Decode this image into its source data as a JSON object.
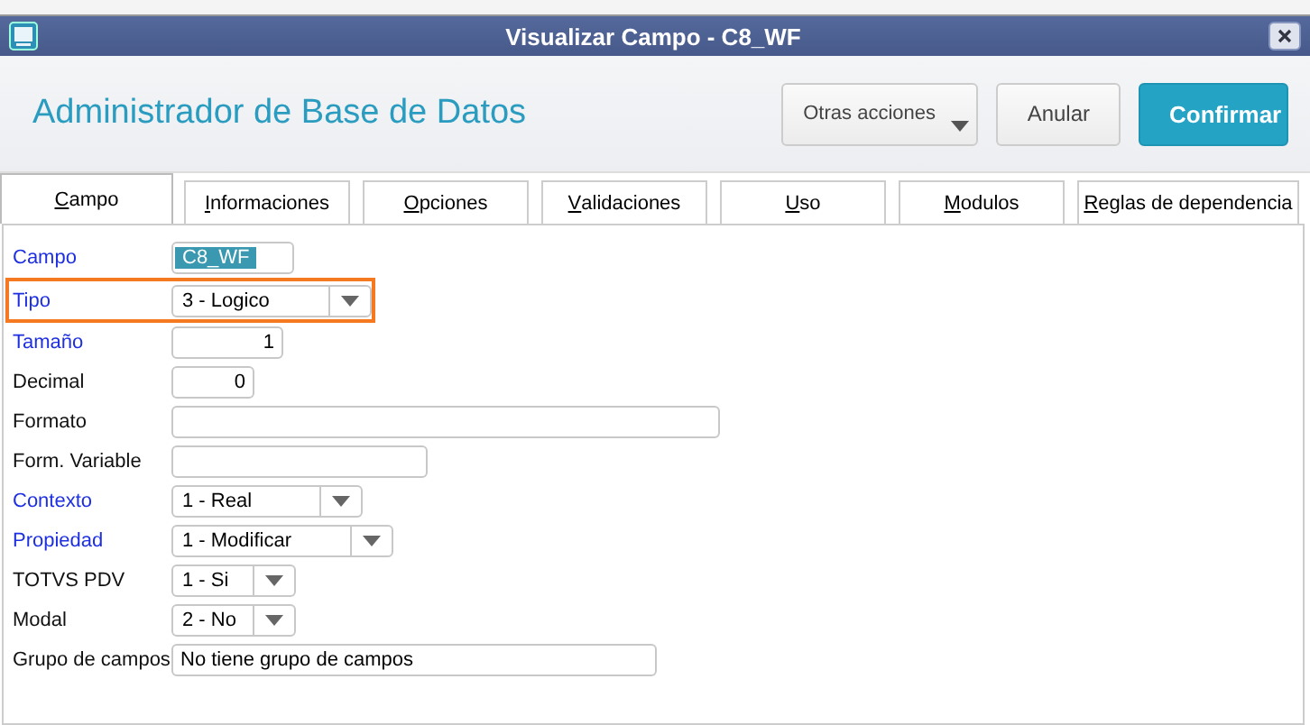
{
  "window": {
    "title": "Visualizar Campo - C8_WF"
  },
  "header": {
    "title": "Administrador de Base de Datos",
    "buttons": [
      {
        "label": "Otras acciones",
        "kind": "menu"
      },
      {
        "label": "Anular",
        "kind": "plain"
      },
      {
        "label": "Confirmar",
        "kind": "primary"
      }
    ]
  },
  "tabs": [
    {
      "label": "Campo",
      "selected": true
    },
    {
      "label": "Informaciones",
      "selected": false
    },
    {
      "label": "Opciones",
      "selected": false
    },
    {
      "label": "Validaciones",
      "selected": false
    },
    {
      "label": "Uso",
      "selected": false
    },
    {
      "label": "Modulos",
      "selected": false
    },
    {
      "label": "Reglas de dependencia",
      "selected": false
    }
  ],
  "fields": [
    {
      "label": "Campo",
      "required": true,
      "kind": "text",
      "value": "C8_WF",
      "text_selected": true,
      "highlighted": false
    },
    {
      "label": "Tipo",
      "required": true,
      "kind": "select",
      "value": "3 - Logico",
      "highlighted": true
    },
    {
      "label": "Tamaño",
      "required": true,
      "kind": "number",
      "value": "1",
      "text_selected": false,
      "highlighted": false
    },
    {
      "label": "Decimal",
      "required": false,
      "kind": "number",
      "value": "0",
      "text_selected": false,
      "highlighted": false
    },
    {
      "label": "Formato",
      "required": false,
      "kind": "text",
      "highlighted": false
    },
    {
      "label": "Form. Variable",
      "required": false,
      "kind": "text",
      "highlighted": false
    },
    {
      "label": "Contexto",
      "required": true,
      "kind": "select",
      "value": "1 - Real",
      "highlighted": false
    },
    {
      "label": "Propiedad",
      "required": true,
      "kind": "select",
      "value": "1 - Modificar",
      "highlighted": false
    },
    {
      "label": "TOTVS PDV",
      "required": false,
      "kind": "select",
      "value": "1 - Si",
      "highlighted": false
    },
    {
      "label": "Modal",
      "required": false,
      "kind": "select",
      "value": "2 - No",
      "highlighted": false
    },
    {
      "label": "Grupo de campos",
      "required": false,
      "kind": "text",
      "value": "No tiene grupo de campos",
      "text_selected": false,
      "highlighted": false
    }
  ]
}
